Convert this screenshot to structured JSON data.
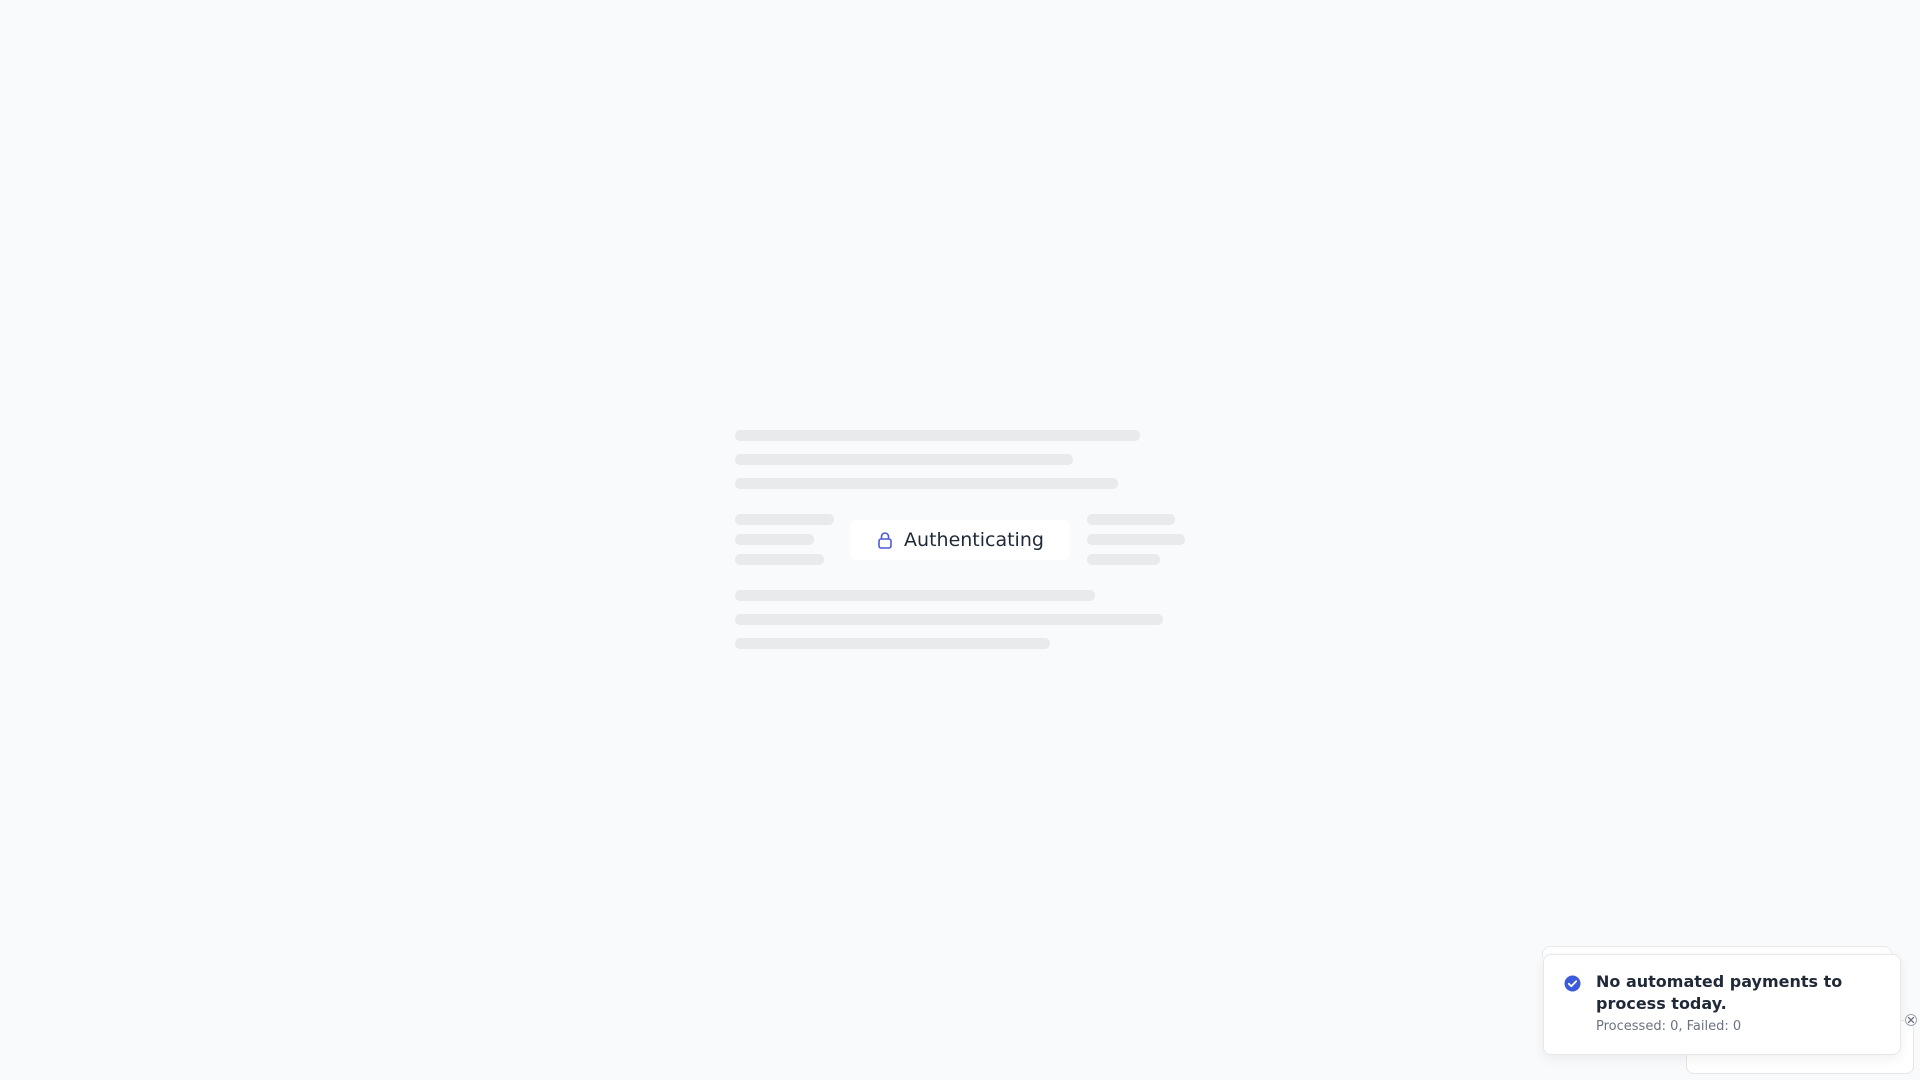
{
  "auth": {
    "label": "Authenticating",
    "icon": "lock-icon",
    "accent": "#4f5bd5"
  },
  "toast": {
    "icon": "check-circle-icon",
    "accent": "#3b5bdb",
    "title": "No automated payments to process today.",
    "description": "Processed: 0, Failed: 0"
  }
}
